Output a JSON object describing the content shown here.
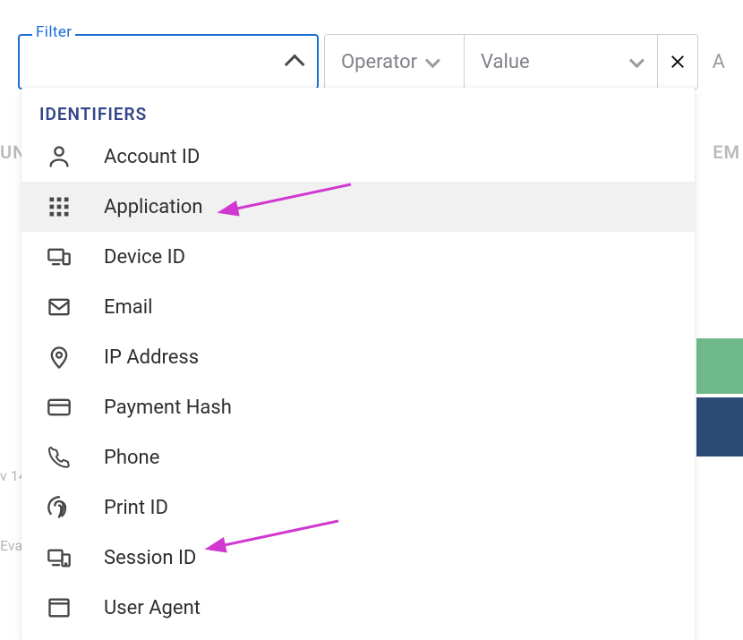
{
  "filterbar": {
    "filter_label": "Filter",
    "filter_value": "",
    "operator_label": "Operator",
    "value_label": "Value",
    "add_more_label": "A"
  },
  "dropdown": {
    "section_header": "IDENTIFIERS",
    "items": [
      {
        "icon": "person-icon",
        "label": "Account ID"
      },
      {
        "icon": "grid-icon",
        "label": "Application"
      },
      {
        "icon": "devices-icon",
        "label": "Device ID"
      },
      {
        "icon": "email-icon",
        "label": "Email"
      },
      {
        "icon": "location-icon",
        "label": "IP Address"
      },
      {
        "icon": "card-icon",
        "label": "Payment Hash"
      },
      {
        "icon": "phone-icon",
        "label": "Phone"
      },
      {
        "icon": "fingerprint-icon",
        "label": "Print ID"
      },
      {
        "icon": "session-icon",
        "label": "Session ID"
      },
      {
        "icon": "browser-icon",
        "label": "User Agent"
      }
    ],
    "highlighted_index": 1
  },
  "background": {
    "col_header_left_fragment": "UN",
    "col_header_right": "EM",
    "faint_row1": "v 14",
    "faint_row2": "Eva"
  },
  "annotation_color": "#d138d1"
}
